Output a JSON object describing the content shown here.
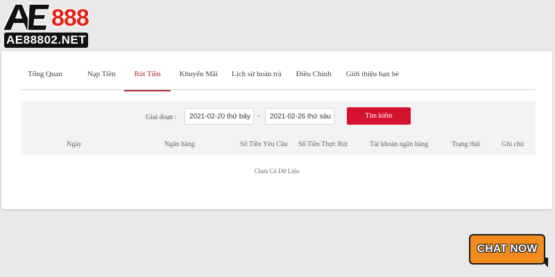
{
  "brand": {
    "logo_number": "888",
    "site_url": "AE88802.NET",
    "colors": {
      "red": "#e2231a",
      "dark": "#111111"
    }
  },
  "tabs": [
    {
      "label": "Tổng Quan",
      "active": false
    },
    {
      "label": "Nạp Tiền",
      "active": false
    },
    {
      "label": "Rút Tiền",
      "active": true
    },
    {
      "label": "Khuyến Mãi",
      "active": false
    },
    {
      "label": "Lịch sử hoàn trả",
      "active": false
    },
    {
      "label": "Điều Chỉnh",
      "active": false
    },
    {
      "label": "Giới thiệu bạn bè",
      "active": false
    }
  ],
  "filter": {
    "label": "Giai đoạn :",
    "date_from": "2021-02-20 thứ bảy",
    "separator": "-",
    "date_to": "2021-02-26 thứ sáu",
    "search_label": "Tìm kiếm"
  },
  "table": {
    "columns": [
      "Ngày",
      "Ngân hàng",
      "Số Tiền Yêu Cầu",
      "Số Tiền Thực Rút",
      "Tài khoản ngân hàng",
      "Trạng thái",
      "Ghi chú"
    ],
    "empty_text": "Chưa Có Dữ Liệu"
  },
  "chat": {
    "label": "CHAT NOW"
  },
  "colors": {
    "accent": "#b3202f",
    "button": "#d6132f",
    "chat_orange": "#f28a1e"
  }
}
